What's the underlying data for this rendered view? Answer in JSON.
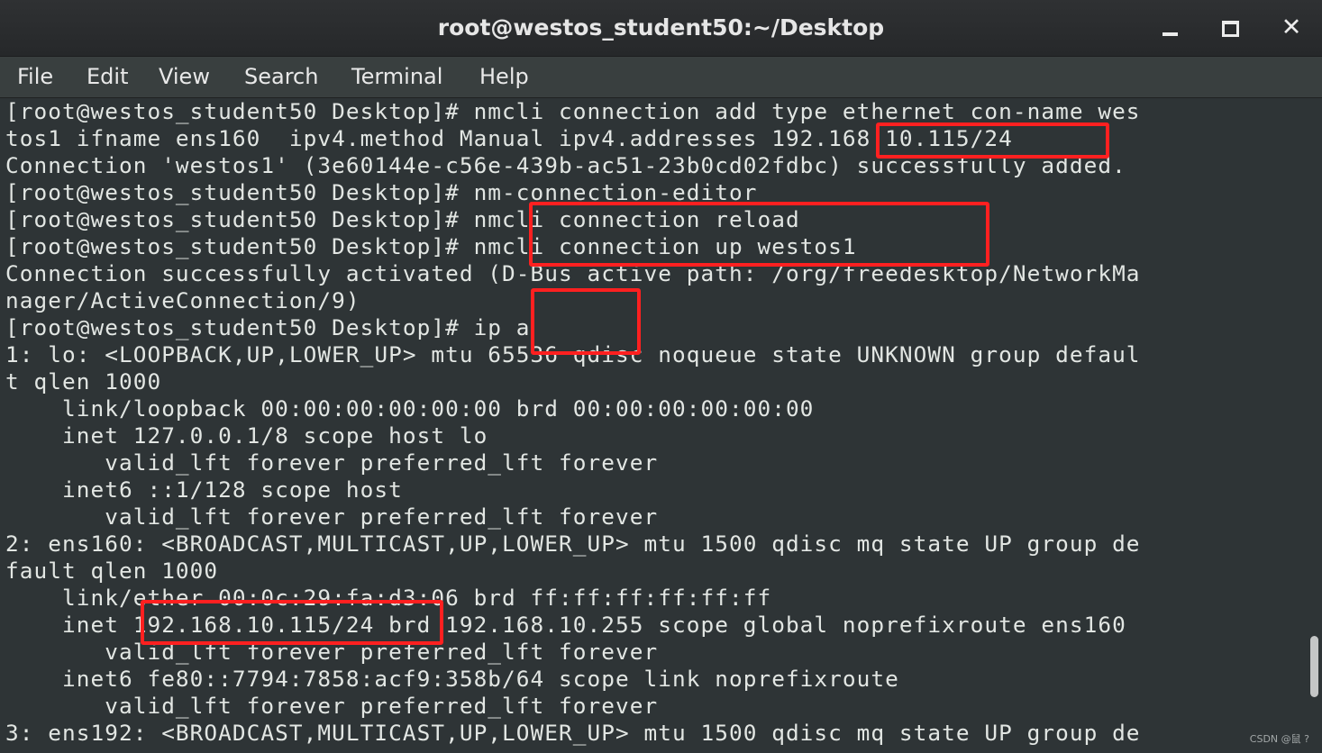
{
  "window": {
    "title": "root@westos_student50:~/Desktop",
    "controls": {
      "minimize_icon": "minimize-icon",
      "maximize_icon": "maximize-icon",
      "close_icon": "close-icon",
      "close_glyph": "✕"
    }
  },
  "menu": {
    "items": [
      "File",
      "Edit",
      "View",
      "Search",
      "Terminal",
      "Help"
    ]
  },
  "terminal": {
    "lines": [
      "[root@westos_student50 Desktop]# nmcli connection add type ethernet con-name wes",
      "tos1 ifname ens160  ipv4.method Manual ipv4.addresses 192.168.10.115/24",
      "Connection 'westos1' (3e60144e-c56e-439b-ac51-23b0cd02fdbc) successfully added.",
      "[root@westos_student50 Desktop]# nm-connection-editor",
      "[root@westos_student50 Desktop]# nmcli connection reload",
      "[root@westos_student50 Desktop]# nmcli connection up westos1",
      "Connection successfully activated (D-Bus active path: /org/freedesktop/NetworkMa",
      "nager/ActiveConnection/9)",
      "[root@westos_student50 Desktop]# ip a",
      "1: lo: <LOOPBACK,UP,LOWER_UP> mtu 65536 qdisc noqueue state UNKNOWN group defaul",
      "t qlen 1000",
      "    link/loopback 00:00:00:00:00:00 brd 00:00:00:00:00:00",
      "    inet 127.0.0.1/8 scope host lo",
      "       valid_lft forever preferred_lft forever",
      "    inet6 ::1/128 scope host",
      "       valid_lft forever preferred_lft forever",
      "2: ens160: <BROADCAST,MULTICAST,UP,LOWER_UP> mtu 1500 qdisc mq state UP group de",
      "fault qlen 1000",
      "    link/ether 00:0c:29:fa:d3:06 brd ff:ff:ff:ff:ff:ff",
      "    inet 192.168.10.115/24 brd 192.168.10.255 scope global noprefixroute ens160",
      "       valid_lft forever preferred_lft forever",
      "    inet6 fe80::7794:7858:acf9:358b/64 scope link noprefixroute",
      "       valid_lft forever preferred_lft forever",
      "3: ens192: <BROADCAST,MULTICAST,UP,LOWER_UP> mtu 1500 qdisc mq state UP group de"
    ]
  },
  "annotations": {
    "color": "#ff2020"
  },
  "colors": {
    "terminal_background": "#2e3436",
    "terminal_foreground": "#e2e6e3",
    "titlebar_background": "#2b2d2f",
    "menubar_background": "#393f3f"
  },
  "watermark": "CSDN @鼠 ?"
}
